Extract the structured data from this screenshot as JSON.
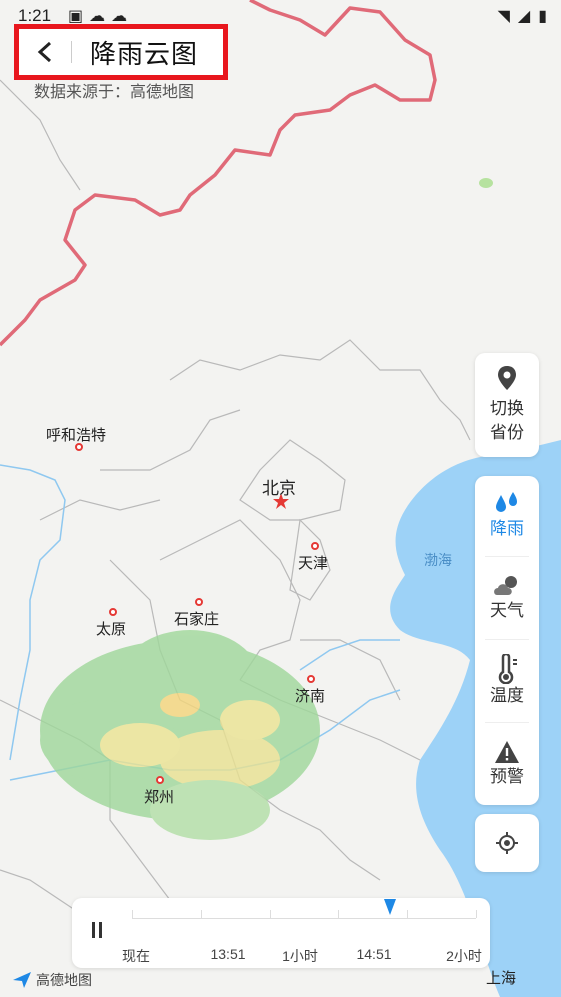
{
  "status_bar": {
    "time": "1:21"
  },
  "header": {
    "title": "降雨云图",
    "source": "数据来源于：高德地图"
  },
  "side_panel": {
    "switch_province": "切换\n省份",
    "rain": "降雨",
    "weather": "天气",
    "temperature": "温度",
    "warning": "预警"
  },
  "cities": {
    "huhehaote": "呼和浩特",
    "beijing": "北京",
    "tianjin": "天津",
    "taiyuan": "太原",
    "shijiazhuang": "石家庄",
    "jinan": "济南",
    "zhengzhou": "郑州",
    "shanghai": "上海"
  },
  "sea_label": "渤海",
  "timeline": {
    "labels": [
      "现在",
      "13:51",
      "1小时",
      "14:51",
      "2小时"
    ],
    "current_index": 3
  },
  "map_logo": "高德地图",
  "colors": {
    "accent": "#1e88e5",
    "highlight": "#e8161d",
    "border": "#e06a78",
    "sea": "#9dd2f7"
  }
}
